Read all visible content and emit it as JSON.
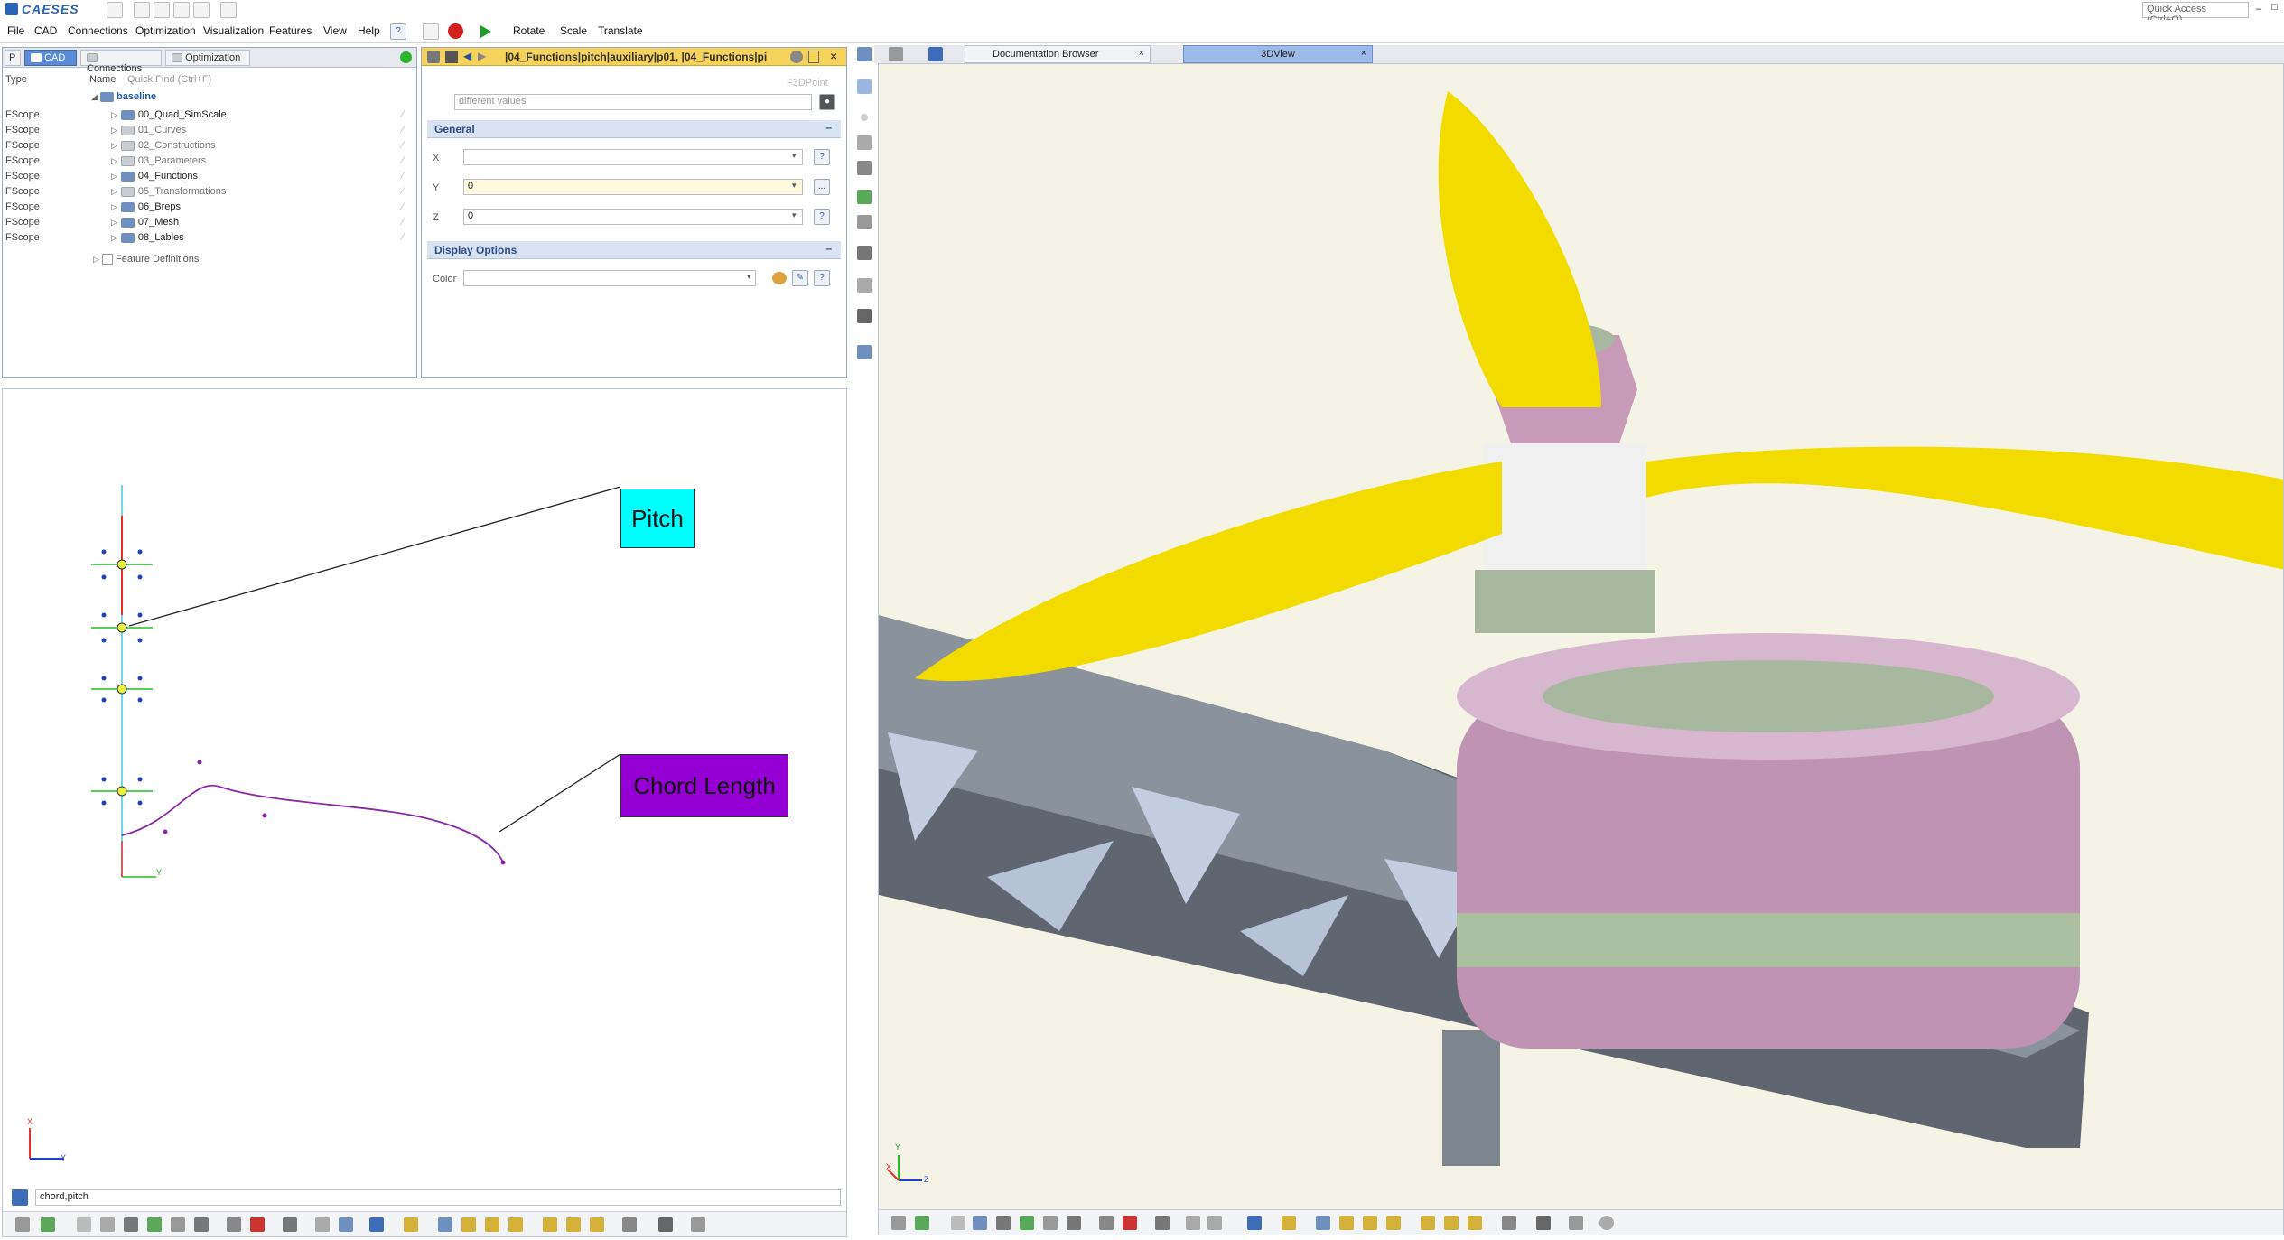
{
  "app": {
    "logo": "CAESES"
  },
  "menu": [
    "File",
    "CAD",
    "Connections",
    "Optimization",
    "Visualization",
    "Features",
    "View",
    "Help"
  ],
  "toolbar": {
    "rotate": "Rotate",
    "scale": "Scale",
    "translate": "Translate",
    "quick_access": "Quick Access (Ctrl+Q)"
  },
  "left_tabs": {
    "p": "P",
    "cad": "CAD",
    "connections": "Connections",
    "optimization": "Optimization"
  },
  "tree": {
    "col_type": "Type",
    "col_name": "Name",
    "quick_find": "Quick Find (Ctrl+F)",
    "root": "baseline",
    "rows": [
      {
        "type": "FScope",
        "name": "00_Quad_SimScale",
        "empty": false
      },
      {
        "type": "FScope",
        "name": "01_Curves",
        "empty": true
      },
      {
        "type": "FScope",
        "name": "02_Constructions",
        "empty": true
      },
      {
        "type": "FScope",
        "name": "03_Parameters",
        "empty": true
      },
      {
        "type": "FScope",
        "name": "04_Functions",
        "empty": false
      },
      {
        "type": "FScope",
        "name": "05_Transformations",
        "empty": true
      },
      {
        "type": "FScope",
        "name": "06_Breps",
        "empty": false
      },
      {
        "type": "FScope",
        "name": "07_Mesh",
        "empty": false
      },
      {
        "type": "FScope",
        "name": "08_Lables",
        "empty": false
      }
    ],
    "feature_definitions": "Feature Definitions"
  },
  "props": {
    "title": "|04_Functions|pitch|auxiliary|p01, |04_Functions|pi",
    "type_label": "F3DPoint",
    "placeholder": "different values",
    "general": "General",
    "x_label": "X",
    "x_value": "",
    "y_label": "Y",
    "y_value": "0",
    "z_label": "Z",
    "z_value": "0",
    "display_options": "Display Options",
    "color_label": "Color",
    "help": "?",
    "ellipsis": "..."
  },
  "view2d": {
    "label_pitch": "Pitch",
    "label_chord": "Chord Length",
    "axis_y": "Y",
    "axis_x": "X",
    "filter_value": "chord,pitch"
  },
  "view3d": {
    "tab_doc": "Documentation Browser",
    "tab_3d": "3DView",
    "axis_x": "X",
    "axis_y": "Y",
    "axis_z": "Z"
  },
  "colors": {
    "pitch_label_bg": "#00ffff",
    "chord_label_bg": "#9400d3",
    "accent": "#2b4f8a",
    "propeller": "#f2dc00",
    "arm": "#5f6670",
    "motor": "#c79ab8",
    "background3d": "#f5f3e6"
  }
}
